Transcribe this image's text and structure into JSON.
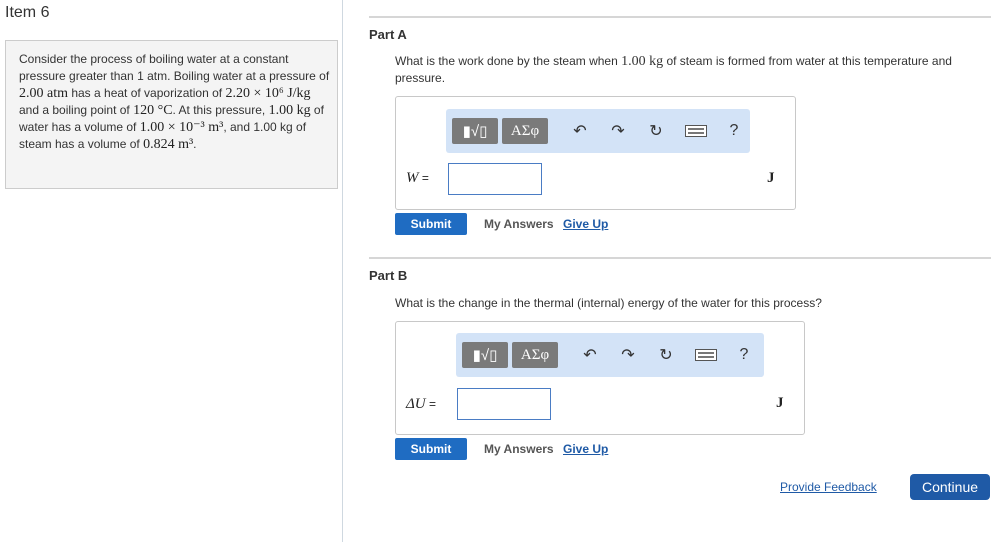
{
  "item": {
    "title": "Item 6"
  },
  "problem": {
    "segments": [
      {
        "t": "Consider the process of boiling water at a constant pressure greater than 1 atm. Boiling water at a pressure of ",
        "math": false
      },
      {
        "t": "2.00 atm",
        "math": true
      },
      {
        "t": " has a heat of vaporization of ",
        "math": false
      },
      {
        "t": "2.20 × 10⁶ J/kg",
        "math": true
      },
      {
        "t": " and a boiling point of ",
        "math": false
      },
      {
        "t": "120 °C",
        "math": true
      },
      {
        "t": ". At this pressure, ",
        "math": false
      },
      {
        "t": "1.00 kg",
        "math": true
      },
      {
        "t": " of water has a volume of ",
        "math": false
      },
      {
        "t": "1.00 × 10⁻³ m³",
        "math": true
      },
      {
        "t": ", and 1.00 kg of steam has a volume of ",
        "math": false
      },
      {
        "t": "0.824 m³",
        "math": true
      },
      {
        "t": ".",
        "math": false
      }
    ]
  },
  "toolbar": {
    "template_glyph": "▮√▯",
    "greek_label": "ΑΣφ",
    "undo_icon": "undo-icon",
    "redo_icon": "redo-icon",
    "reset_icon": "reset-icon",
    "keyboard_icon": "keyboard-icon",
    "help_label": "?"
  },
  "partA": {
    "title": "Part A",
    "question_segments": [
      {
        "t": "What is the work done by the steam when ",
        "math": false
      },
      {
        "t": "1.00 kg",
        "math": true
      },
      {
        "t": " of steam is formed from water at this temperature and pressure.",
        "math": false
      }
    ],
    "var_label": "W",
    "eq": " =",
    "input_value": "",
    "unit": "J",
    "submit_label": "Submit",
    "my_answers_label": "My Answers",
    "give_up_label": "Give Up"
  },
  "partB": {
    "title": "Part B",
    "question": "What is the change in the thermal (internal) energy of the water for this process?",
    "var_label": "ΔU",
    "eq": " =",
    "input_value": "",
    "unit": "J",
    "submit_label": "Submit",
    "my_answers_label": "My Answers",
    "give_up_label": "Give Up"
  },
  "footer": {
    "feedback_label": "Provide Feedback",
    "continue_label": "Continue"
  },
  "colors": {
    "accent": "#1f6cc2",
    "toolbar_bg": "#d3e3f7",
    "link": "#1f5aa6"
  }
}
